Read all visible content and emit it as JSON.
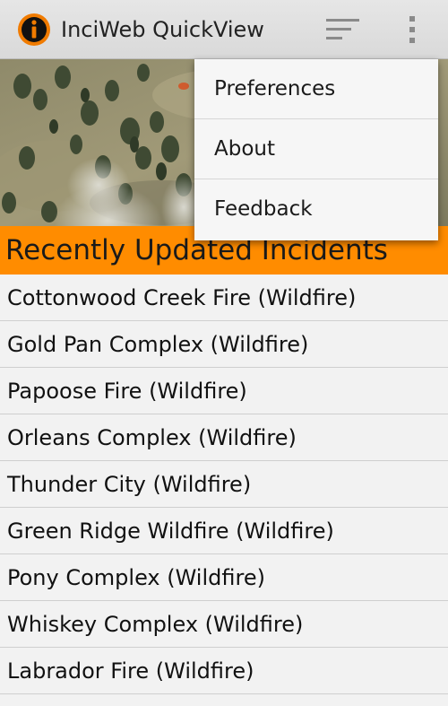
{
  "app": {
    "title": "InciWeb QuickView",
    "icon": "info-icon"
  },
  "toolbar": {
    "sort_icon": "sort-icon",
    "overflow_icon": "overflow-menu-icon"
  },
  "colors": {
    "accent": "#ff8c00",
    "app_icon_ring": "#f07b00",
    "action_bar": "#dcdcdc",
    "list_background": "#f2f2f2"
  },
  "section": {
    "title": "Recently Updated Incidents"
  },
  "menu": {
    "items": [
      "Preferences",
      "About",
      "Feedback"
    ]
  },
  "incidents": [
    "Cottonwood Creek Fire (Wildfire)",
    "Gold Pan Complex (Wildfire)",
    "Papoose Fire (Wildfire)",
    "Orleans Complex (Wildfire)",
    "Thunder City (Wildfire)",
    "Green Ridge Wildfire (Wildfire)",
    "Pony Complex (Wildfire)",
    "Whiskey Complex (Wildfire)",
    "Labrador Fire (Wildfire)"
  ]
}
